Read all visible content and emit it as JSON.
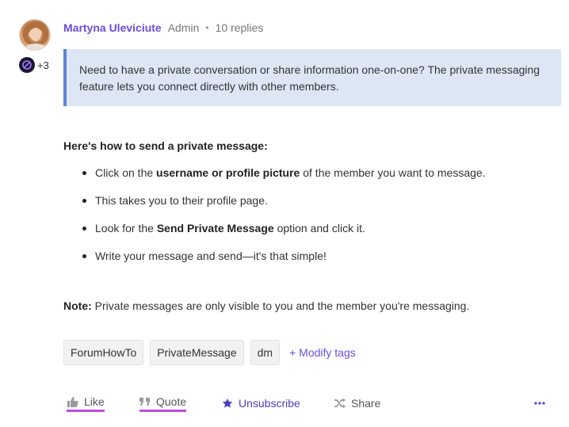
{
  "post": {
    "author": "Martyna Uleviciute",
    "role": "Admin",
    "separator": "•",
    "replies": "10 replies",
    "badge_count": "+3"
  },
  "callout": {
    "text": "Need to have a private conversation or share information one-on-one? The private messaging feature lets you connect directly with other members."
  },
  "howto": {
    "title": "Here's how to send a private message:",
    "steps": [
      {
        "pre": "Click on the ",
        "bold1": "username",
        "mid": " or ",
        "bold2": "profile picture",
        "post": " of the member you want to message."
      },
      {
        "text": "This takes you to their profile page."
      },
      {
        "pre": "Look for the ",
        "bold": "Send Private Message",
        "post": " option and click it."
      },
      {
        "text": "Write your message and send—it's that simple!"
      }
    ]
  },
  "note": {
    "label": "Note:",
    "text": " Private messages are only visible to you and the member you're messaging."
  },
  "tags": {
    "items": [
      "ForumHowTo",
      "PrivateMessage",
      "dm"
    ],
    "modify_label": "+ Modify tags"
  },
  "actions": {
    "like": "Like",
    "quote": "Quote",
    "unsubscribe": "Unsubscribe",
    "share": "Share"
  },
  "colors": {
    "accent": "#6a4dd8",
    "callout_bg": "#dde6f4",
    "callout_border": "#5b86d6",
    "underline": "#c04ae0"
  },
  "icons": {
    "avatar": "user-photo",
    "badge": "slashed-circle-badge-icon",
    "like": "thumbs-up-icon",
    "quote": "quote-icon",
    "unsubscribe": "star-icon",
    "share": "shuffle-icon",
    "more": "ellipsis-icon"
  }
}
